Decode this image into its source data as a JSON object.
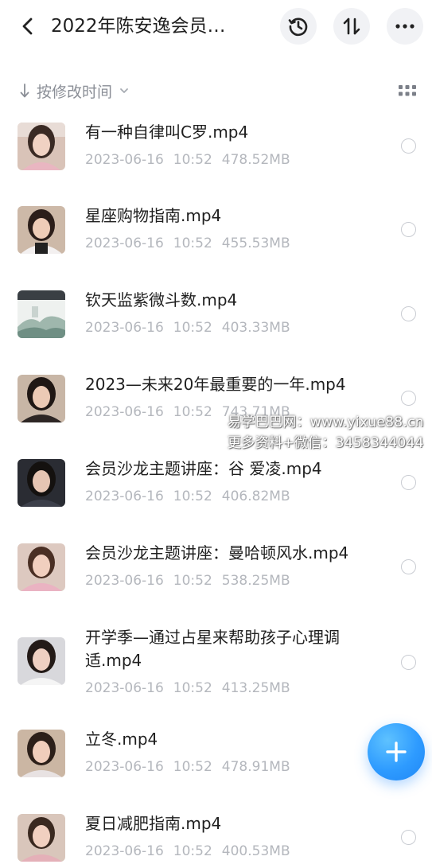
{
  "header": {
    "title": "2022年陈安逸会员…",
    "back_icon": "chevron-left-icon",
    "history_icon": "history-clock-icon",
    "sort_icon": "sort-arrows-icon",
    "more_icon": "more-dots-icon"
  },
  "sortbar": {
    "label": "按修改时间",
    "arrow_icon": "arrow-down-icon",
    "caret_icon": "chevron-down-icon",
    "view_icon": "grid-view-icon"
  },
  "files": [
    {
      "name": "有一种自律叫C罗.mp4",
      "date": "2023-06-16",
      "time": "10:52",
      "size": "478.52MB"
    },
    {
      "name": "星座购物指南.mp4",
      "date": "2023-06-16",
      "time": "10:52",
      "size": "455.53MB"
    },
    {
      "name": "钦天监紫微斗数.mp4",
      "date": "2023-06-16",
      "time": "10:52",
      "size": "403.33MB"
    },
    {
      "name": "2023—未来20年最重要的一年.mp4",
      "date": "2023-06-16",
      "time": "10:52",
      "size": "743.71MB"
    },
    {
      "name": "会员沙龙主题讲座：谷 爱凌.mp4",
      "date": "2023-06-16",
      "time": "10:52",
      "size": "406.82MB"
    },
    {
      "name": "会员沙龙主题讲座：曼哈顿风水.mp4",
      "date": "2023-06-16",
      "time": "10:52",
      "size": "538.25MB"
    },
    {
      "name": "开学季—通过占星来帮助孩子心理调适.mp4",
      "date": "2023-06-16",
      "time": "10:52",
      "size": "413.25MB"
    },
    {
      "name": "立冬.mp4",
      "date": "2023-06-16",
      "time": "10:52",
      "size": "478.91MB"
    },
    {
      "name": "夏日减肥指南.mp4",
      "date": "2023-06-16",
      "time": "10:52",
      "size": "400.53MB"
    }
  ],
  "watermark": {
    "line1": "易学巴巴网：www.yixue88.cn",
    "line2": "更多资料+微信：3458344044"
  },
  "fab": {
    "icon": "plus-icon"
  },
  "colors": {
    "accent": "#2e9bff",
    "meta_text": "#b4b7bd",
    "sort_text": "#8a8e96",
    "button_bg": "#f1f2f5"
  }
}
